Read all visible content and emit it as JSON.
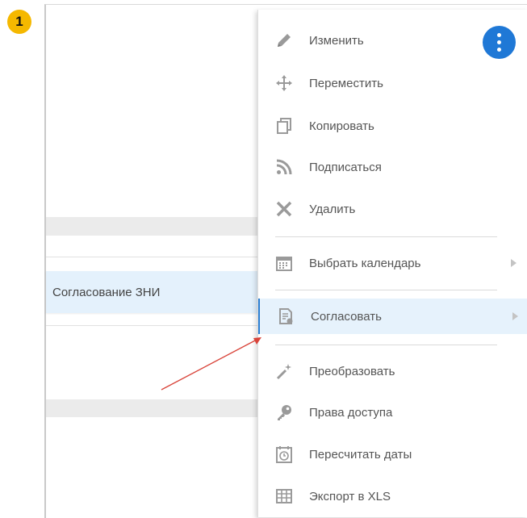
{
  "step_badge": "1",
  "task": {
    "name": "Согласование ЗНИ"
  },
  "menu": {
    "items": [
      {
        "label": "Изменить",
        "icon": "pencil-icon"
      },
      {
        "label": "Переместить",
        "icon": "move-icon"
      },
      {
        "label": "Копировать",
        "icon": "copy-icon"
      },
      {
        "label": "Подписаться",
        "icon": "rss-icon"
      },
      {
        "label": "Удалить",
        "icon": "close-icon"
      },
      {
        "label": "Выбрать календарь",
        "icon": "calendar-icon",
        "has_submenu": true
      },
      {
        "label": "Согласовать",
        "icon": "approve-doc-icon",
        "has_submenu": true,
        "active": true
      },
      {
        "label": "Преобразовать",
        "icon": "magic-wand-icon"
      },
      {
        "label": "Права доступа",
        "icon": "key-icon"
      },
      {
        "label": "Пересчитать даты",
        "icon": "clock-calendar-icon"
      },
      {
        "label": "Экспорт в XLS",
        "icon": "table-icon"
      }
    ]
  },
  "colors": {
    "badge": "#f5b800",
    "kebab": "#1f78d6",
    "active_row": "#e6f2fc",
    "annotation_arrow": "#d9443a"
  }
}
